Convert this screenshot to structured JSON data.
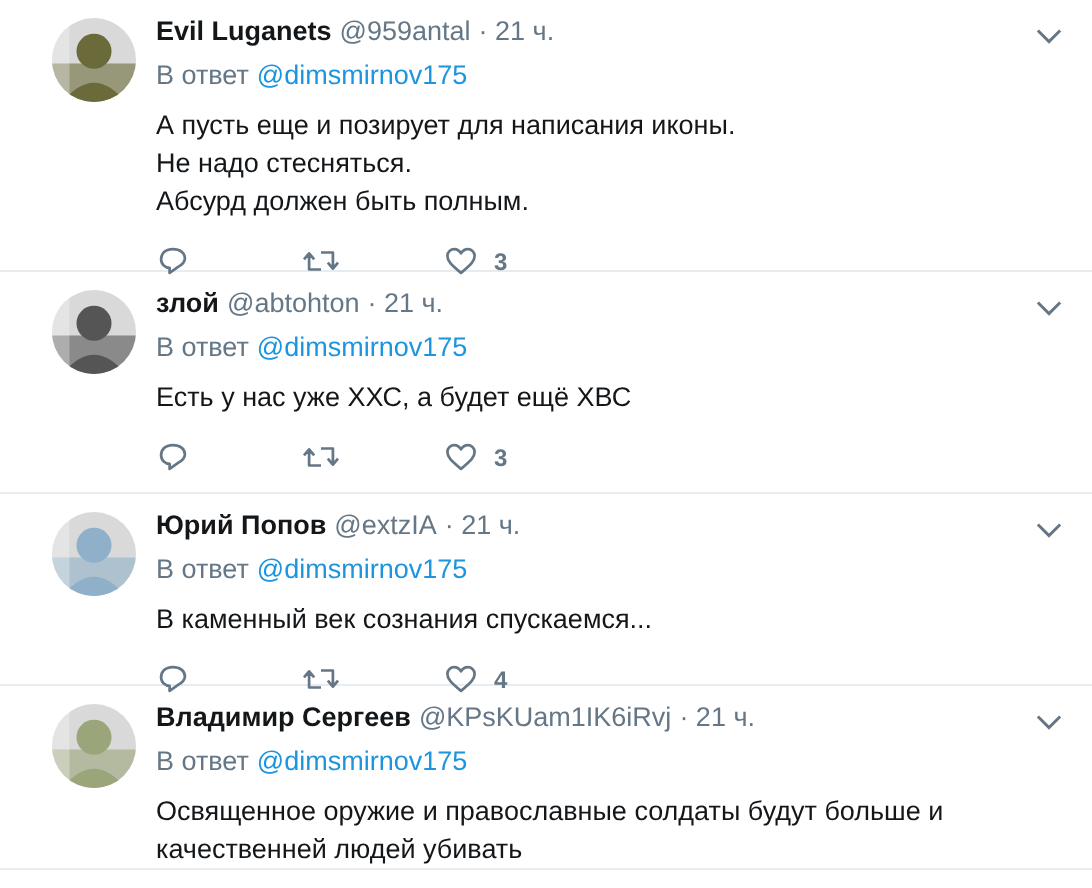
{
  "tweets": [
    {
      "name": "Evil Luganets",
      "handle": "@959antal",
      "time": "· 21 ч.",
      "reply_prefix": "В ответ",
      "reply_to": "@dimsmirnov175",
      "text": [
        "А пусть еще и позирует для написания иконы.",
        "Не надо стесняться.",
        "Абсурд должен быть полным."
      ],
      "likes": "3",
      "avatar": {
        "kind": "picture"
      }
    },
    {
      "name": "злой",
      "handle": "@abtohton",
      "time": "· 21 ч.",
      "reply_prefix": "В ответ",
      "reply_to": "@dimsmirnov175",
      "text": [
        "Есть у нас уже ХХС, а будет ещё ХВС"
      ],
      "likes": "3",
      "avatar": {
        "kind": "picture"
      }
    },
    {
      "name": "Юрий Попов",
      "handle": "@extzIA",
      "time": "· 21 ч.",
      "reply_prefix": "В ответ",
      "reply_to": "@dimsmirnov175",
      "text": [
        "В каменный век сознания спускаемся..."
      ],
      "likes": "4",
      "avatar": {
        "kind": "picture"
      }
    },
    {
      "name": "Владимир Сергеев",
      "handle": "@KPsKUam1IK6iRvj",
      "time": "· 21 ч.",
      "reply_prefix": "В ответ",
      "reply_to": "@dimsmirnov175",
      "text": [
        "Освященное оружие и православные солдаты будут больше и качественней людей убивать"
      ],
      "avatar": {
        "kind": "picture"
      }
    }
  ]
}
